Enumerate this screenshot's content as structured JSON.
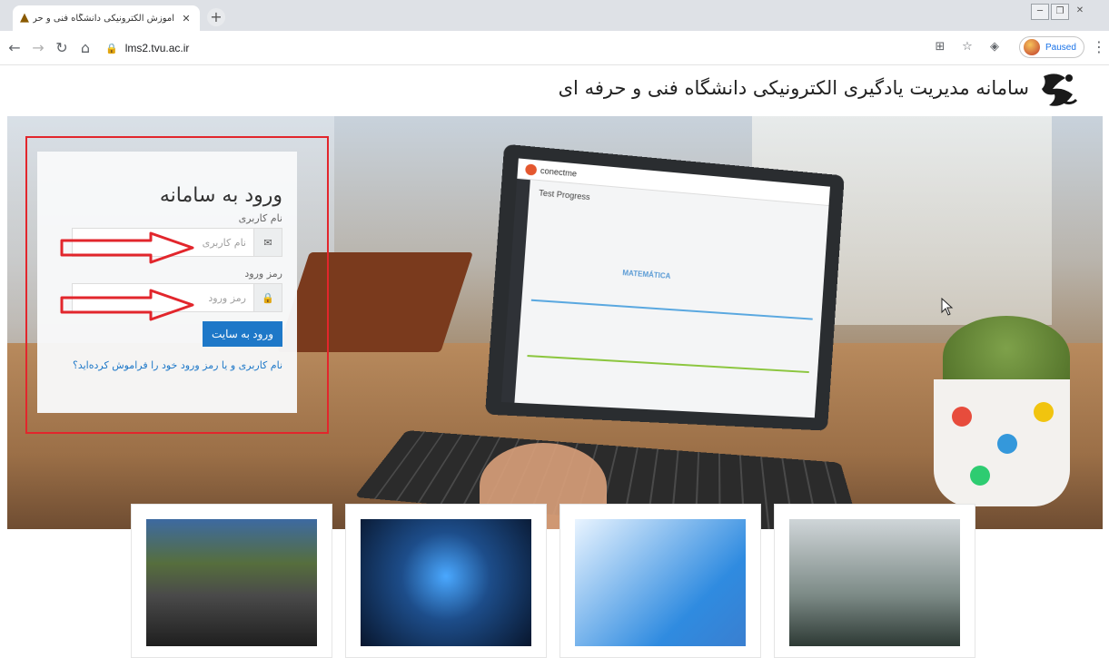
{
  "browser": {
    "tab_title": "آموزش الکترونیکی دانشگاه فنی و حرفه ای",
    "url": "lms2.tvu.ac.ir",
    "profile_status": "Paused",
    "accent_color": "#1a73e8"
  },
  "site": {
    "title": "سامانه مدیریت یادگیری الکترونیکی دانشگاه فنی و حرفه ای"
  },
  "login": {
    "title": "ورود به سامانه",
    "username_label": "نام کاربری",
    "username_placeholder": "نام کاربری",
    "password_label": "رمز ورود",
    "password_placeholder": "رمز ورود",
    "submit_label": "ورود به سایت",
    "forgot_link": "نام کاربری و یا رمز ورود خود را فراموش کرده‌اید؟",
    "button_color": "#1e78c8"
  },
  "laptop": {
    "brand": "conectme",
    "heading": "Test Progress",
    "subheading": "MATEMÁTICA"
  },
  "annotation": {
    "box_color": "#e2262c"
  },
  "icons": {
    "username_icon": "envelope-icon",
    "password_icon": "lock-icon"
  }
}
